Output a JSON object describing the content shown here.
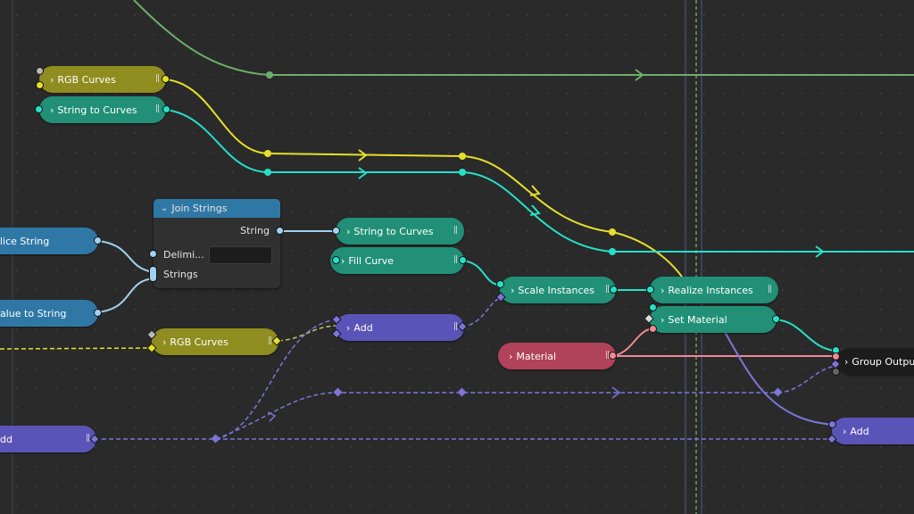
{
  "nodes": {
    "rgb_curves_top": "RGB Curves",
    "string_to_curves_top": "String to Curves",
    "slice_string": "lice String",
    "value_to_string": "alue to String",
    "join_strings": {
      "title": "Join Strings",
      "output": "String",
      "delimiter": "Delimi...",
      "strings": "Strings"
    },
    "string_to_curves_mid": "String to Curves",
    "fill_curve": "Fill Curve",
    "scale_instances": "Scale Instances",
    "realize_instances": "Realize Instances",
    "set_material": "Set Material",
    "rgb_curves_mid": "RGB Curves",
    "add_mid": "Add",
    "material": "Material",
    "group_output": "Group Output",
    "add_left": "dd",
    "add_right": "Add"
  },
  "icons": {
    "chevron": "›",
    "grip": "||"
  },
  "colors": {
    "geometry": "#27e0c8",
    "color": "#e6e02a",
    "string": "#9fd2ee",
    "float": "#7c76d8",
    "material": "#f08a95",
    "green_wire": "#6fae6a"
  }
}
